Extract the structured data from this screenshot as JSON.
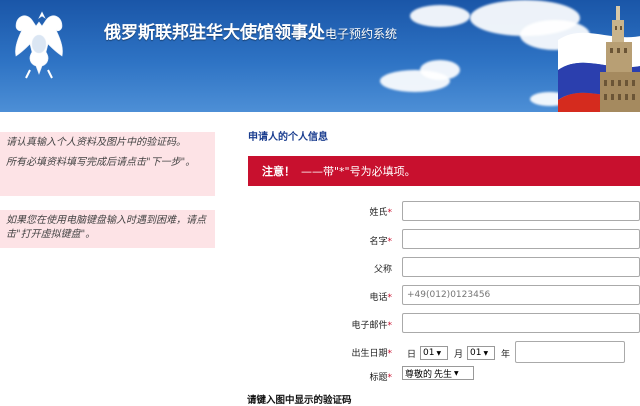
{
  "header": {
    "title_main": "俄罗斯联邦驻华大使馆领事处",
    "title_sub": "电子预约系统"
  },
  "left": {
    "box1_line1": "请认真输入个人资料及图片中的验证码。",
    "box1_line2": "所有必填资料填写完成后请点击\"下一步\"。",
    "box2": "如果您在使用电脑键盘输入时遇到困难，请点击\"打开虚拟键盘\"。"
  },
  "form": {
    "section_title": "申请人的个人信息",
    "notice_label": "注意！",
    "notice_text": "——带\"*\"号为必填项。",
    "fields": {
      "surname": "姓氏",
      "name": "名字",
      "patronymic": "父称",
      "phone": "电话",
      "phone_placeholder": "+49(012)0123456",
      "email": "电子邮件",
      "birthdate": "出生日期",
      "title": "标题"
    },
    "required_mark": "*",
    "birth": {
      "day_label": "日",
      "day_value": "01",
      "month_label": "月",
      "month_value": "01",
      "year_label": "年"
    },
    "title_select": {
      "value1": "尊敬的",
      "value2": "先生"
    },
    "captcha_label": "请键入图中显示的验证码"
  },
  "colors": {
    "header_blue": "#1a56a8",
    "alert_red": "#c8102e",
    "info_pink": "#fde3e6"
  }
}
